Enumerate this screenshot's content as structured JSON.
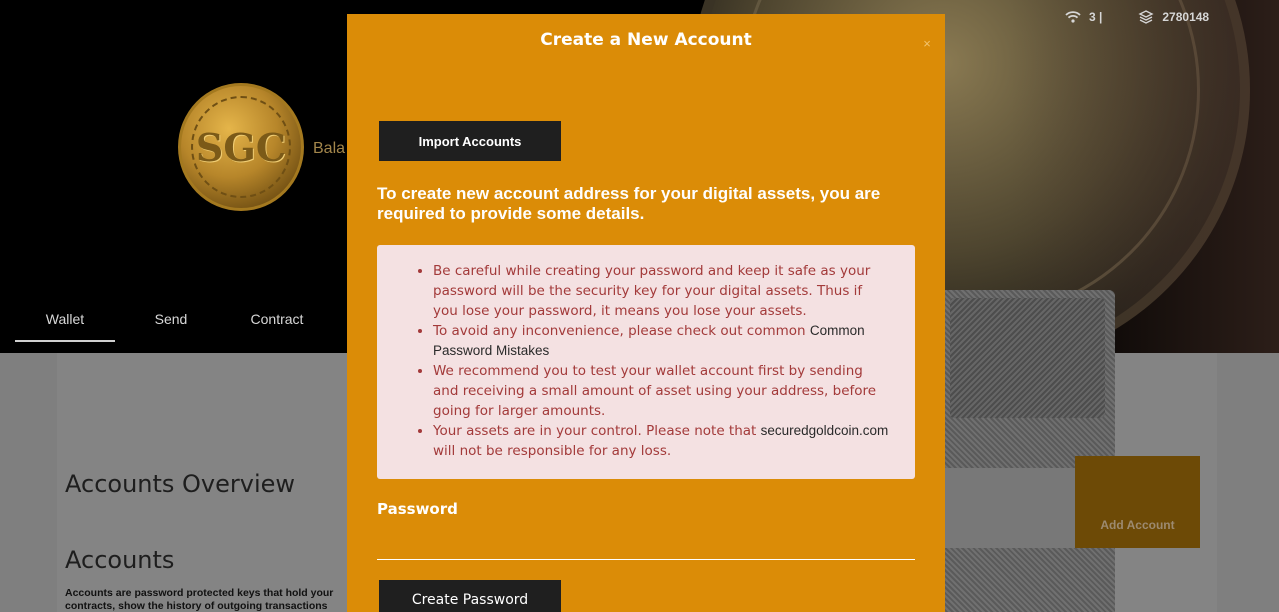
{
  "status": {
    "peers": "3 |",
    "block": "2780148"
  },
  "header": {
    "logo_text": "SGC",
    "balance_label": "Bala"
  },
  "nav": {
    "tabs": [
      {
        "label": "Wallet",
        "active": true
      },
      {
        "label": "Send",
        "active": false
      },
      {
        "label": "Contract",
        "active": false
      }
    ]
  },
  "main": {
    "overview_title": "Accounts Overview",
    "accounts_title": "Accounts",
    "accounts_desc": "Accounts are password protected keys that hold your contracts, show the history of outgoing transactions",
    "add_account_label": "Add Account"
  },
  "modal": {
    "title": "Create a New Account",
    "close_label": "×",
    "import_label": "Import Accounts",
    "intro": "To create new account address for your digital assets, you are required to provide some details.",
    "warnings": {
      "w1": "Be careful while creating your password and keep it safe as your password will be the security key for your digital assets. Thus if you lose your password, it means you lose your assets.",
      "w2_text": "To avoid any inconvenience, please check out common ",
      "w2_link": "Common Password Mistakes",
      "w3": "We recommend you to test your wallet account first by sending and receiving a small amount of asset using your address, before going for larger amounts.",
      "w4_text": "Your assets are in your control. Please note that ",
      "w4_link": "securedgoldcoin.com",
      "w4_tail": " will not be responsible for any loss."
    },
    "password_label": "Password",
    "password_value": "",
    "create_password_label": "Create Password"
  },
  "colors": {
    "modal_bg": "#db8c07",
    "button_bg": "#1f1f1f",
    "warning_bg": "#f4e1e2",
    "warning_text": "#a33a3a"
  }
}
